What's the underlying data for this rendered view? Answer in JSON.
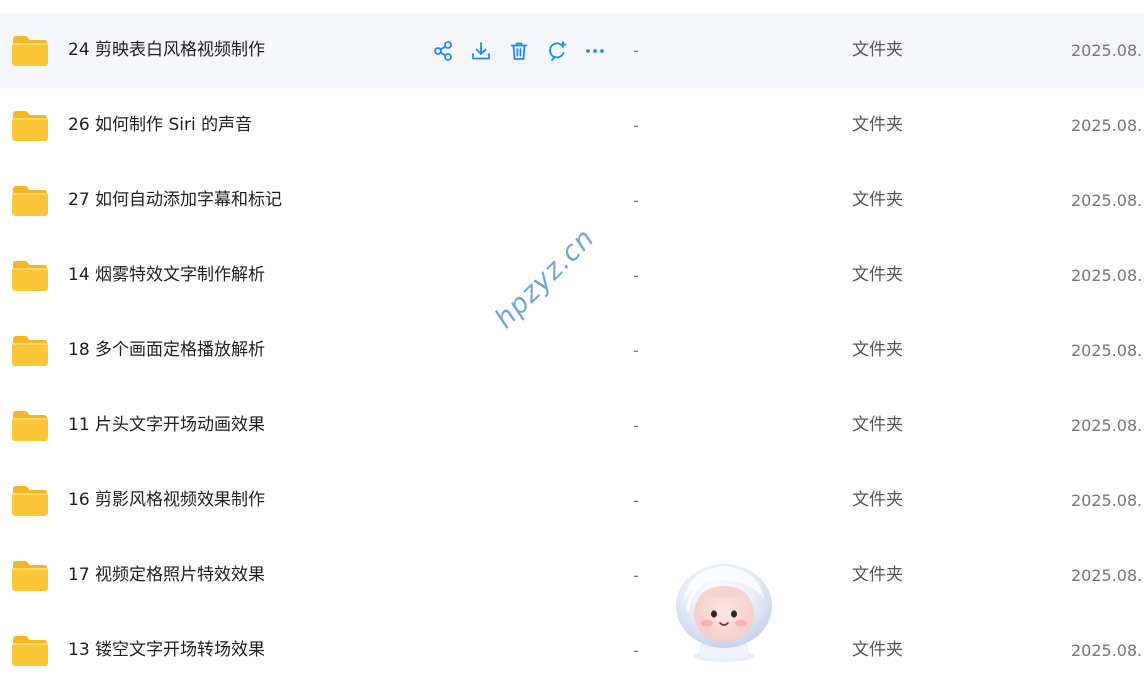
{
  "watermark": "hpzyz.cn",
  "colors": {
    "accent": "#1a8cff",
    "folder": "#fcc639",
    "hover_row": "#f5f7fa"
  },
  "hover_actions": [
    "share-icon",
    "download-icon",
    "delete-icon",
    "refresh-icon",
    "more-icon"
  ],
  "files": [
    {
      "name": "24 剪映表白风格视频制作",
      "size": "-",
      "type": "文件夹",
      "date": "2025.08."
    },
    {
      "name": "26 如何制作 Siri 的声音",
      "size": "-",
      "type": "文件夹",
      "date": "2025.08."
    },
    {
      "name": "27 如何自动添加字幕和标记",
      "size": "-",
      "type": "文件夹",
      "date": "2025.08."
    },
    {
      "name": "14 烟雾特效文字制作解析",
      "size": "-",
      "type": "文件夹",
      "date": "2025.08."
    },
    {
      "name": "18 多个画面定格播放解析",
      "size": "-",
      "type": "文件夹",
      "date": "2025.08."
    },
    {
      "name": "11 片头文字开场动画效果",
      "size": "-",
      "type": "文件夹",
      "date": "2025.08."
    },
    {
      "name": "16 剪影风格视频效果制作",
      "size": "-",
      "type": "文件夹",
      "date": "2025.08."
    },
    {
      "name": "17 视频定格照片特效效果",
      "size": "-",
      "type": "文件夹",
      "date": "2025.08."
    },
    {
      "name": "13 镂空文字开场转场效果",
      "size": "-",
      "type": "文件夹",
      "date": "2025.08."
    }
  ]
}
